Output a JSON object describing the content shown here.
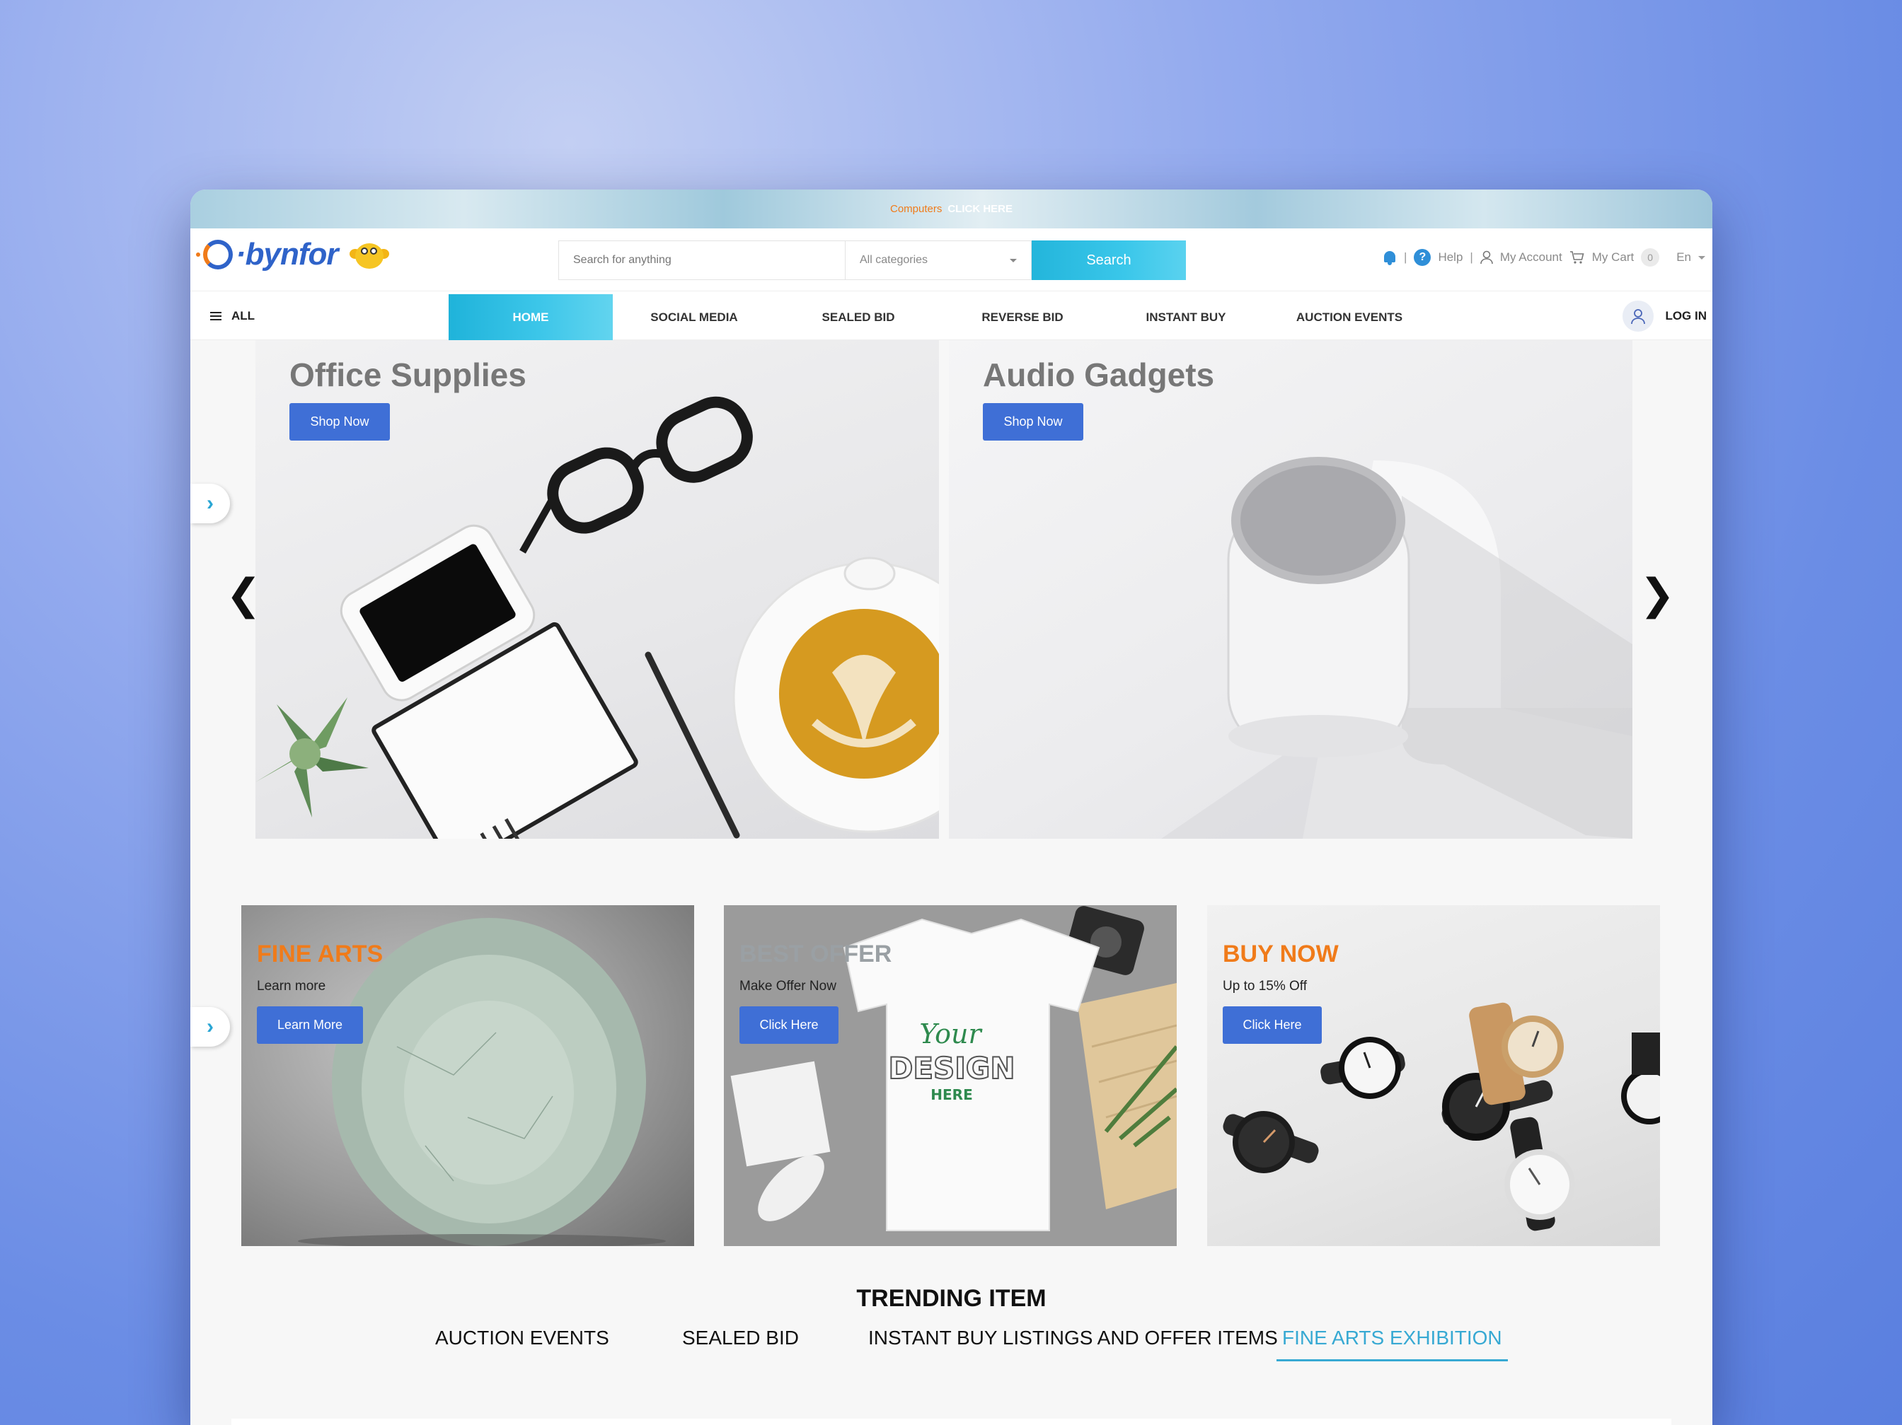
{
  "promo_bar": {
    "category": "Computers",
    "cta": "CLICK HERE"
  },
  "brand": {
    "name": "bynfor"
  },
  "search": {
    "placeholder": "Search for anything",
    "category": "All categories",
    "button": "Search"
  },
  "utility": {
    "help": "Help",
    "account": "My Account",
    "cart": "My Cart",
    "cart_count": "0",
    "language": "En"
  },
  "nav": {
    "all": "ALL",
    "items": [
      "HOME",
      "SOCIAL MEDIA",
      "SEALED BID",
      "REVERSE BID",
      "INSTANT BUY",
      "AUCTION EVENTS"
    ],
    "login": "LOG IN"
  },
  "hero": {
    "banners": [
      {
        "title": "Office Supplies",
        "button": "Shop Now"
      },
      {
        "title": "Audio Gadgets",
        "button": "Shop Now"
      }
    ],
    "prev": "❮",
    "next": "❯"
  },
  "promos": [
    {
      "title": "FINE ARTS",
      "subtitle": "Learn more",
      "button": "Learn More"
    },
    {
      "title": "BEST OFFER",
      "subtitle": "Make Offer Now",
      "button": "Click Here",
      "artwork": {
        "line1": "Your",
        "line2": "DESIGN",
        "line3": "HERE"
      }
    },
    {
      "title": "BUY NOW",
      "subtitle": "Up to 15% Off",
      "button": "Click Here"
    }
  ],
  "trending": {
    "title": "TRENDING ITEM",
    "tabs": [
      "AUCTION EVENTS",
      "SEALED BID",
      "INSTANT BUY LISTINGS AND OFFER ITEMS",
      "FINE ARTS EXHIBITION"
    ],
    "active_tab": "FINE ARTS EXHIBITION"
  },
  "colors": {
    "accent": "#37a9d3",
    "brand_blue": "#3f6fd6",
    "orange": "#f07b1a"
  }
}
